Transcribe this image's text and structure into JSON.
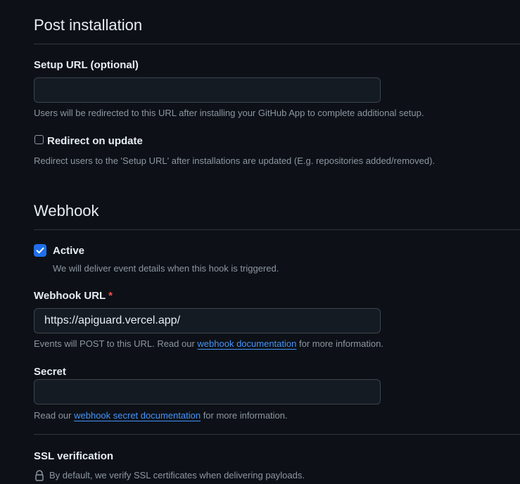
{
  "post_installation": {
    "heading": "Post installation",
    "setup_url": {
      "label": "Setup URL (optional)",
      "value": "",
      "note": "Users will be redirected to this URL after installing your GitHub App to complete additional setup."
    },
    "redirect_on_update": {
      "label": "Redirect on update",
      "checked": false,
      "note": "Redirect users to the 'Setup URL' after installations are updated (E.g. repositories added/removed)."
    }
  },
  "webhook": {
    "heading": "Webhook",
    "active": {
      "label": "Active",
      "checked": true,
      "note": "We will deliver event details when this hook is triggered."
    },
    "url": {
      "label": "Webhook URL",
      "required_mark": "*",
      "value": "https://apiguard.vercel.app/",
      "note_prefix": "Events will POST to this URL. Read our",
      "note_link": "webhook documentation",
      "note_suffix": "for more information."
    },
    "secret": {
      "label": "Secret",
      "value": "",
      "note_prefix": "Read our",
      "note_link": "webhook secret documentation",
      "note_suffix": "for more information."
    },
    "ssl": {
      "label": "SSL verification",
      "note": "By default, we verify SSL certificates when delivering payloads."
    }
  },
  "colors": {
    "background": "#0d1117",
    "accent": "#1f6feb",
    "link": "#4493f8",
    "required": "#f85149"
  }
}
